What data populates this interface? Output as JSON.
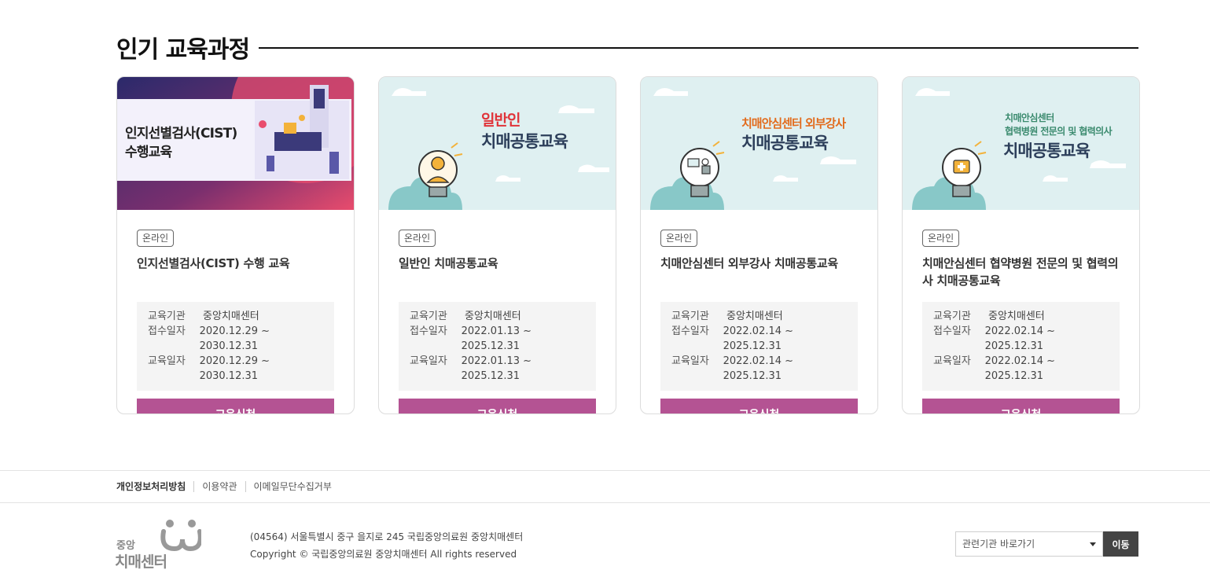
{
  "section": {
    "title": "인기 교육과정"
  },
  "cards": [
    {
      "thumb_lines": [
        "인지선별검사(CIST)",
        "수행교육"
      ],
      "tag": "온라인",
      "title": "인지선별검사(CIST) 수행 교육",
      "info": {
        "org_label": "교육기관",
        "org": "중앙치매센터",
        "reg_label": "접수일자",
        "reg": "2020.12.29 ~ 2030.12.31",
        "edu_label": "교육일자",
        "edu": "2020.12.29 ~ 2030.12.31"
      },
      "button": "교육신청"
    },
    {
      "thumb_sub": "일반인",
      "thumb_main": "치매공통교육",
      "tag": "온라인",
      "title": "일반인 치매공통교육",
      "info": {
        "org_label": "교육기관",
        "org": "중앙치매센터",
        "reg_label": "접수일자",
        "reg": "2022.01.13 ~ 2025.12.31",
        "edu_label": "교육일자",
        "edu": "2022.01.13 ~ 2025.12.31"
      },
      "button": "교육신청"
    },
    {
      "thumb_sub": "치매안심센터 외부강사",
      "thumb_main": "치매공통교육",
      "tag": "온라인",
      "title": "치매안심센터 외부강사 치매공통교육",
      "info": {
        "org_label": "교육기관",
        "org": "중앙치매센터",
        "reg_label": "접수일자",
        "reg": "2022.02.14 ~ 2025.12.31",
        "edu_label": "교육일자",
        "edu": "2022.02.14 ~ 2025.12.31"
      },
      "button": "교육신청"
    },
    {
      "thumb_small": [
        "치매안심센터",
        "협력병원 전문의 및 협력의사"
      ],
      "thumb_main": "치매공통교육",
      "tag": "온라인",
      "title": "치매안심센터 협약병원 전문의 및 협력의사 치매공통교육",
      "info": {
        "org_label": "교육기관",
        "org": "중앙치매센터",
        "reg_label": "접수일자",
        "reg": "2022.02.14 ~ 2025.12.31",
        "edu_label": "교육일자",
        "edu": "2022.02.14 ~ 2025.12.31"
      },
      "button": "교육신청"
    }
  ],
  "footer": {
    "links": [
      "개인정보처리방침",
      "이용약관",
      "이메일무단수집거부"
    ],
    "logo_small": "중앙",
    "logo_big": "치매센터",
    "address": "(04564) 서울특별시 중구 을지로 245 국립중앙의료원 중앙치매센터",
    "copyright": "Copyright © 국립중앙의료원 중앙치매센터 All rights reserved",
    "related_placeholder": "관련기관 바로가기",
    "related_go": "이동"
  },
  "colors": {
    "accent": "#b45393",
    "thumb_bg": "#dff0f1",
    "cist_dark": "#2b2a6b",
    "cist_pink": "#e94c6d"
  }
}
